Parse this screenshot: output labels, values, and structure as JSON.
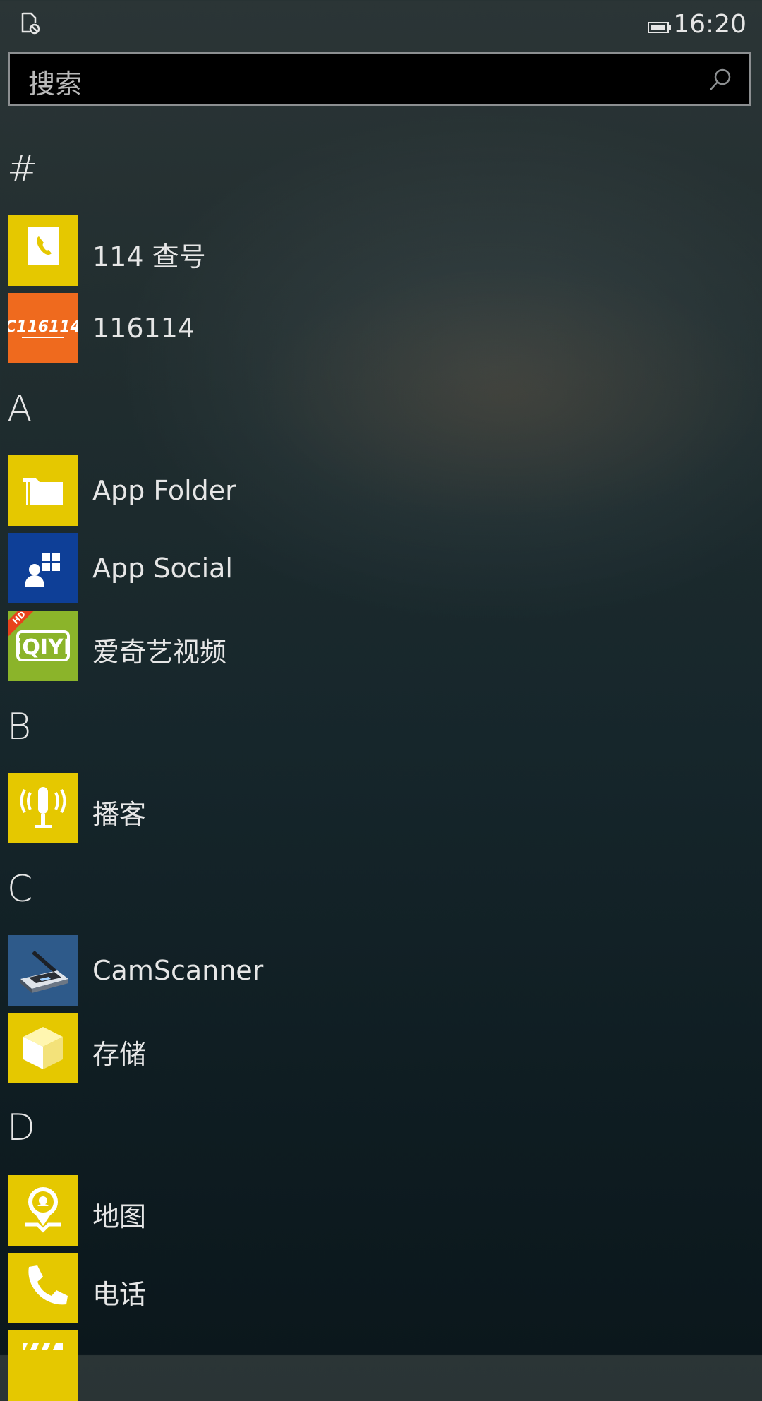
{
  "status_bar": {
    "left_icon": "phone-lock-icon",
    "battery_icon": "battery-icon",
    "time": "16:20"
  },
  "search": {
    "placeholder": "搜索",
    "icon": "search-icon"
  },
  "sections": [
    {
      "header": "#",
      "apps": [
        {
          "label": "114 查号",
          "icon": "phonebook-icon",
          "color": "#e5c800"
        },
        {
          "label": "116114",
          "icon": "116114-logo-icon",
          "color": "#ef6a1e"
        }
      ]
    },
    {
      "header": "A",
      "apps": [
        {
          "label": "App Folder",
          "icon": "folder-icon",
          "color": "#e5c800"
        },
        {
          "label": "App Social",
          "icon": "social-icon",
          "color": "#0e3f97"
        },
        {
          "label": "爱奇艺视频",
          "icon": "iqiyi-logo-icon",
          "color": "#8bb42a",
          "badge": "HD"
        }
      ]
    },
    {
      "header": "B",
      "apps": [
        {
          "label": "播客",
          "icon": "microphone-icon",
          "color": "#e5c800"
        }
      ]
    },
    {
      "header": "C",
      "apps": [
        {
          "label": "CamScanner",
          "icon": "scanner-icon",
          "color": "#2e5a8a"
        },
        {
          "label": "存储",
          "icon": "storage-box-icon",
          "color": "#e5c800"
        }
      ]
    },
    {
      "header": "D",
      "apps": [
        {
          "label": "地图",
          "icon": "map-pin-icon",
          "color": "#e5c800"
        },
        {
          "label": "电话",
          "icon": "phone-icon",
          "color": "#e5c800"
        },
        {
          "label": "",
          "icon": "clapperboard-icon",
          "color": "#e5c800"
        }
      ]
    }
  ]
}
